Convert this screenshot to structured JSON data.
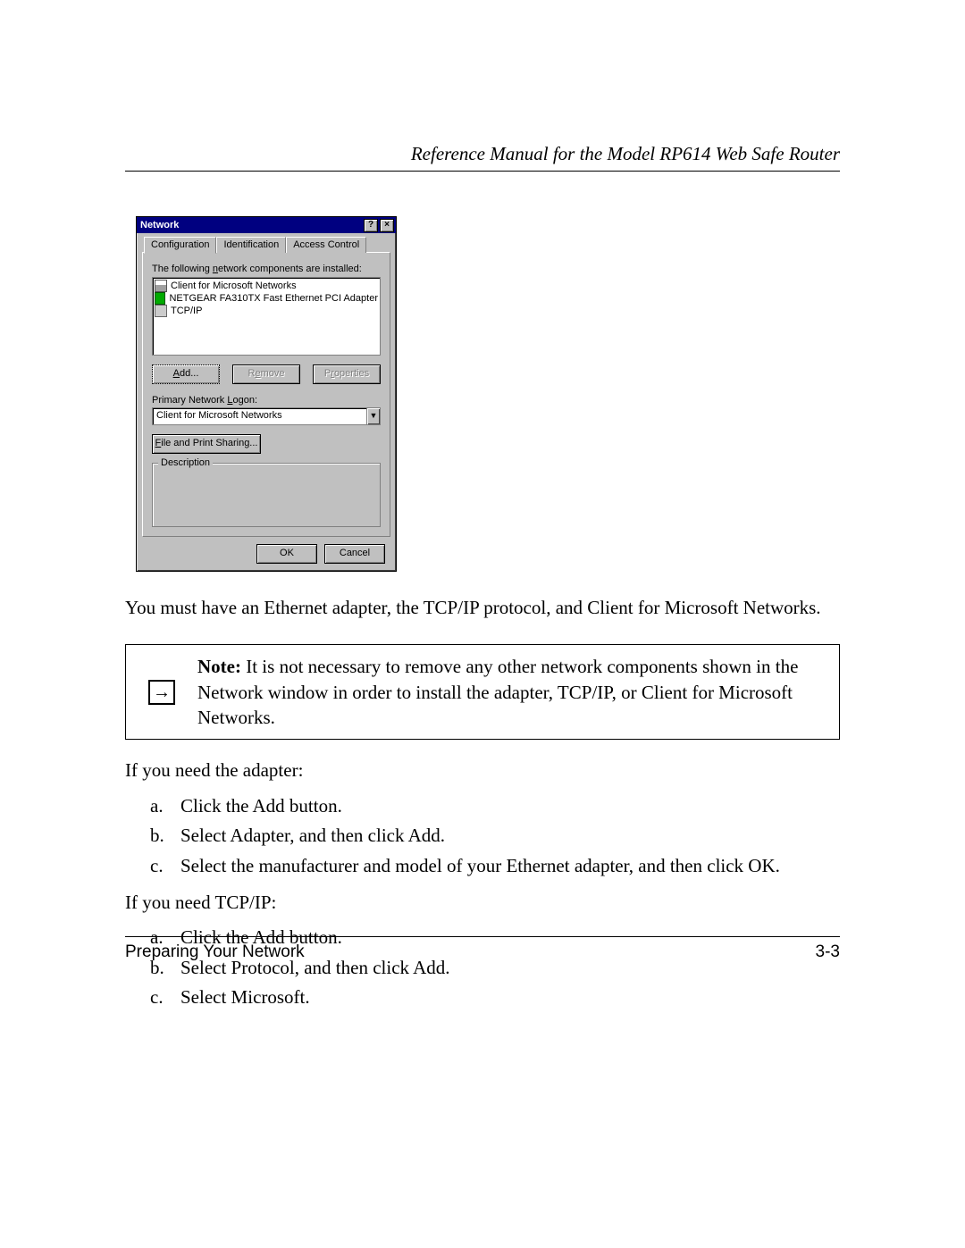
{
  "header": {
    "title": "Reference Manual for the Model RP614 Web Safe Router"
  },
  "dialog": {
    "title": "Network",
    "help_btn": "?",
    "close_btn": "×",
    "tabs": {
      "config": "Configuration",
      "ident": "Identification",
      "access": "Access Control"
    },
    "components_label": "The following network components are installed:",
    "components": [
      "Client for Microsoft Networks",
      "NETGEAR FA310TX Fast Ethernet PCI Adapter",
      "TCP/IP"
    ],
    "buttons": {
      "add": "Add...",
      "remove": "Remove",
      "properties": "Properties"
    },
    "primary_logon_label": "Primary Network Logon:",
    "primary_logon_value": "Client for Microsoft Networks",
    "file_print_sharing": "File and Print Sharing...",
    "description_label": "Description",
    "ok": "OK",
    "cancel": "Cancel"
  },
  "body": {
    "para1": "You must have an Ethernet adapter, the TCP/IP protocol, and Client for Microsoft Networks.",
    "note_label": "Note:",
    "note_text": " It is not necessary to remove any other network components shown in the Network window in order to install the adapter, TCP/IP, or Client for Microsoft Networks.",
    "adapter_intro": "If you need the adapter:",
    "adapter_steps": [
      "Click the Add button.",
      "Select Adapter, and then click Add.",
      "Select the manufacturer and model of your Ethernet adapter, and then click OK."
    ],
    "tcpip_intro": "If you need TCP/IP:",
    "tcpip_steps": [
      "Click the Add button.",
      "Select Protocol, and then click Add.",
      "Select Microsoft."
    ]
  },
  "footer": {
    "left": "Preparing Your Network",
    "right": "3-3"
  }
}
